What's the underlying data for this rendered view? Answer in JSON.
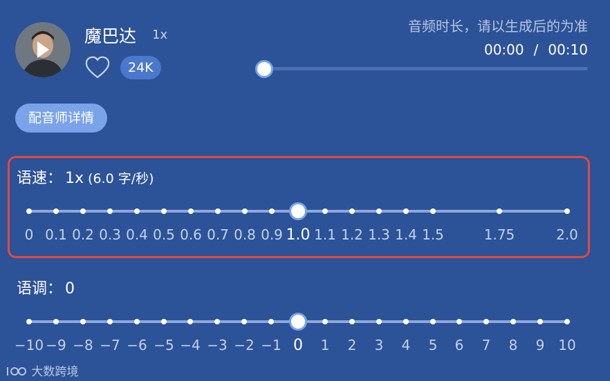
{
  "voice": {
    "name": "魔巴达",
    "speed_tag": "1x",
    "likes": "24K",
    "detail_button": "配音师详情"
  },
  "audio": {
    "note": "音频时长，请以生成后的为准",
    "current_time": "00:00",
    "separator": "/",
    "total_time": "00:10",
    "progress": 0.0
  },
  "speed": {
    "label": "语速：",
    "value": "1x",
    "sub": "(6.0 字/秒)",
    "ticks": [
      "0",
      "0.1",
      "0.2",
      "0.3",
      "0.4",
      "0.5",
      "0.6",
      "0.7",
      "0.8",
      "0.9",
      "1.0",
      "1.1",
      "1.2",
      "1.3",
      "1.4",
      "1.5",
      "1.75",
      "2.0"
    ],
    "selected": "1.0"
  },
  "pitch": {
    "label": "语调：",
    "value": "0",
    "ticks": [
      "-10",
      "-9",
      "-8",
      "-7",
      "-6",
      "-5",
      "-4",
      "-3",
      "-2",
      "-1",
      "0",
      "1",
      "2",
      "3",
      "4",
      "5",
      "6",
      "7",
      "8",
      "9",
      "10"
    ],
    "selected": "0"
  },
  "watermark": "大数跨境",
  "icons": {
    "avatar_play": "play-icon",
    "like": "heart-icon",
    "watermark": "logo-icon"
  },
  "colors": {
    "background": "#2c5298",
    "accent": "#7ba3ea",
    "highlight_border": "#e14a3d"
  }
}
